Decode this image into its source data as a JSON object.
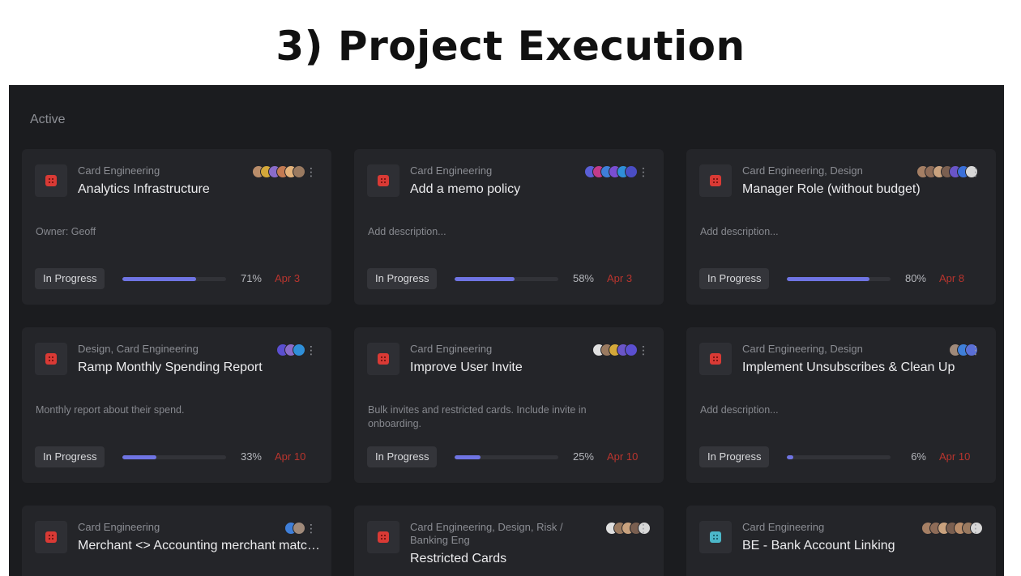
{
  "slide_title": "3) Project Execution",
  "section_label": "Active",
  "colors": {
    "progress": "#6f74e3",
    "due_overdue": "#b8352e",
    "icon_red": "#d93a35",
    "icon_teal": "#4cb7c9"
  },
  "cards": [
    {
      "team": "Card Engineering",
      "name": "Analytics Infrastructure",
      "description": "Owner: Geoff",
      "status": "In Progress",
      "progress": 71,
      "progress_label": "71%",
      "due": "Apr 3",
      "icon": "project-icon-red",
      "avatars": [
        "#b98d6a",
        "#d4a83a",
        "#8a6cc9",
        "#c37a52",
        "#e3b27a",
        "#9a7a60"
      ]
    },
    {
      "team": "Card Engineering",
      "name": "Add a memo policy",
      "description": "Add description...",
      "status": "In Progress",
      "progress": 58,
      "progress_label": "58%",
      "due": "Apr 3",
      "icon": "project-icon-red",
      "avatars": [
        "#5a5fd6",
        "#c23b8a",
        "#3f7fd9",
        "#7a4ed1",
        "#2f8fd8",
        "#4a4dc4"
      ]
    },
    {
      "team": "Card Engineering, Design",
      "name": "Manager Role (without budget)",
      "description": "Add description...",
      "status": "In Progress",
      "progress": 80,
      "progress_label": "80%",
      "due": "Apr 8",
      "icon": "project-icon-red",
      "avatars": [
        "#a57f64",
        "#8e6c58",
        "#c9a27e",
        "#7a5f50",
        "#6a55c8",
        "#3a6fd8",
        "#d7d7d7"
      ]
    },
    {
      "team": "Design, Card Engineering",
      "name": "Ramp Monthly Spending Report",
      "description": "Monthly report about their spend.",
      "status": "In Progress",
      "progress": 33,
      "progress_label": "33%",
      "due": "Apr 10",
      "icon": "project-icon-red",
      "avatars": [
        "#5b4fd0",
        "#8a6cc9",
        "#2f8fd8"
      ]
    },
    {
      "team": "Card Engineering",
      "name": "Improve User Invite",
      "description": "Bulk invites and restricted cards. Include invite in onboarding.",
      "status": "In Progress",
      "progress": 25,
      "progress_label": "25%",
      "due": "Apr 10",
      "icon": "project-icon-red",
      "avatars": [
        "#e0e0e0",
        "#9a7a60",
        "#d4a83a",
        "#6a55c8",
        "#5b4fd0"
      ]
    },
    {
      "team": "Card Engineering, Design",
      "name": "Implement Unsubscribes & Clean Up",
      "description": "Add description...",
      "status": "In Progress",
      "progress": 6,
      "progress_label": "6%",
      "due": "Apr 10",
      "icon": "project-icon-red",
      "avatars": [
        "#a08a7a",
        "#3f7fd9",
        "#5a6fd6"
      ]
    },
    {
      "team": "Card Engineering",
      "name": "Merchant <> Accounting merchant matching",
      "description": "",
      "status": "",
      "progress": null,
      "progress_label": "",
      "due": "",
      "icon": "project-icon-red",
      "avatars": [
        "#3f7fd9",
        "#a08a7a"
      ]
    },
    {
      "team": "Card Engineering, Design, Risk / Banking Eng",
      "name": "Restricted Cards",
      "description": "",
      "status": "",
      "progress": null,
      "progress_label": "",
      "due": "",
      "icon": "project-icon-red",
      "avatars": [
        "#e0e0e0",
        "#9a7a60",
        "#c9a27e",
        "#7a5f50",
        "#d7d7d7"
      ]
    },
    {
      "team": "Card Engineering",
      "name": "BE - Bank Account Linking",
      "description": "",
      "status": "",
      "progress": null,
      "progress_label": "",
      "due": "",
      "icon": "project-icon-teal",
      "avatars": [
        "#a57f64",
        "#8e6c58",
        "#c9a27e",
        "#7a5f50",
        "#b98d6a",
        "#9a7a60",
        "#d7d7d7"
      ]
    }
  ]
}
